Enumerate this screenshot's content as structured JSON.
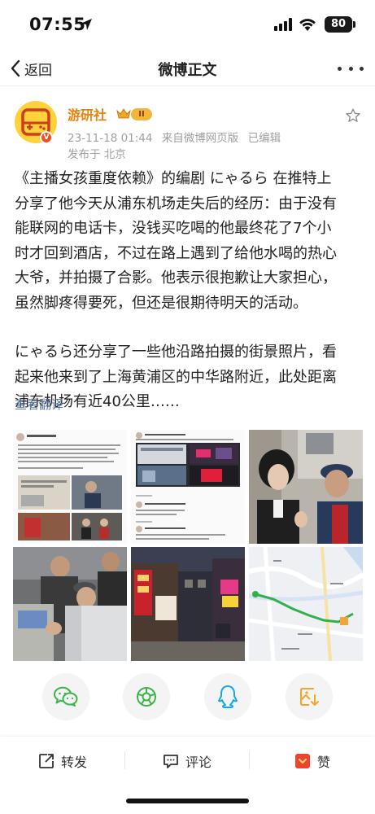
{
  "status_bar": {
    "time": "07:55",
    "battery": "80"
  },
  "nav": {
    "back_label": "返回",
    "title": "微博正文"
  },
  "post": {
    "author": "游研社",
    "level": "II",
    "avatar_badge": "V",
    "date": "23-11-18 01:44",
    "source": "来自微博网页版",
    "edited": "已编辑",
    "location": "发布于 北京",
    "paragraph1_lines": [
      "《主播女孩重度依赖》的编剧 にゃるら 在推特上",
      "分享了他今天从浦东机场走失后的经历：由于没有",
      "能联网的电话卡，没钱买吃喝的他最终花了7个小",
      "时才回到酒店，不过在路上遇到了给他水喝的热心",
      "大爷，并拍摄了合影。他表示很抱歉让大家担心，",
      "虽然脚疼得要死，但还是很期待明天的活动。"
    ],
    "paragraph2_lines": [
      "にゃるら还分享了一些他沿路拍摄的街景照片，看",
      "起来他来到了上海黄浦区的中华路附近，此处距离",
      "浦东机场有近40公里……"
    ],
    "translate": "查看翻译"
  },
  "images": [
    {
      "name": "tweet-screenshot-1",
      "icon": "tweet-screenshot"
    },
    {
      "name": "tweet-screenshot-2",
      "icon": "tweet-screenshot"
    },
    {
      "name": "selfie-photo",
      "icon": "photo"
    },
    {
      "name": "street-photo-men",
      "icon": "photo"
    },
    {
      "name": "night-street-photo",
      "icon": "photo"
    },
    {
      "name": "map-screenshot",
      "icon": "map"
    }
  ],
  "share": [
    "wechat-icon",
    "moments-icon",
    "qq-icon",
    "save-image-icon"
  ],
  "actions": {
    "repost": "转发",
    "comment": "评论",
    "like": "赞"
  },
  "colors": {
    "accent_orange": "#e8820c",
    "link_blue": "#5b78a3",
    "like_red": "#f0422f",
    "wechat_green": "#3bb44a",
    "qq_blue": "#1aa8e8",
    "save_orange": "#f5a623"
  }
}
